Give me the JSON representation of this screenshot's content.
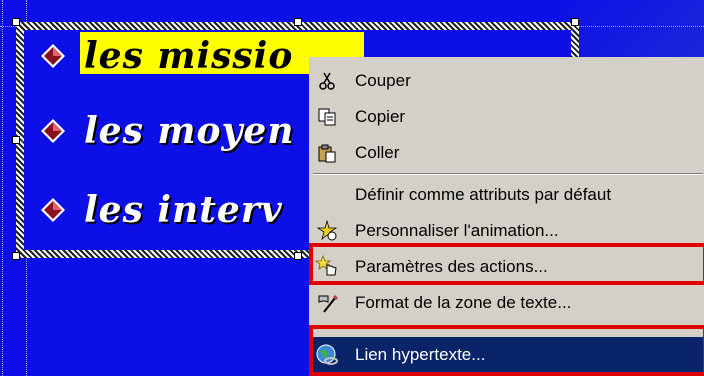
{
  "slide": {
    "lines": [
      {
        "text": "les missio"
      },
      {
        "text": "les moyen"
      },
      {
        "text": "les interv"
      }
    ]
  },
  "context_menu": {
    "items": [
      {
        "label": "Couper",
        "icon": "scissors-icon"
      },
      {
        "label": "Copier",
        "icon": "copy-icon"
      },
      {
        "label": "Coller",
        "icon": "paste-icon"
      },
      {
        "label": "Définir comme attributs par défaut",
        "icon": ""
      },
      {
        "label": "Personnaliser l'animation...",
        "icon": "animation-icon"
      },
      {
        "label": "Paramètres des actions...",
        "icon": "star-hand-icon"
      },
      {
        "label": "Format de la zone de texte...",
        "icon": "format-textbox-icon"
      },
      {
        "label": "Lien hypertexte...",
        "icon": "globe-link-icon"
      }
    ],
    "selected": "Lien hypertexte...",
    "highlighted_items": [
      "Paramètres des actions...",
      "Lien hypertexte..."
    ],
    "highlight_color": "#e00000",
    "selection_color": "#0a246a"
  }
}
